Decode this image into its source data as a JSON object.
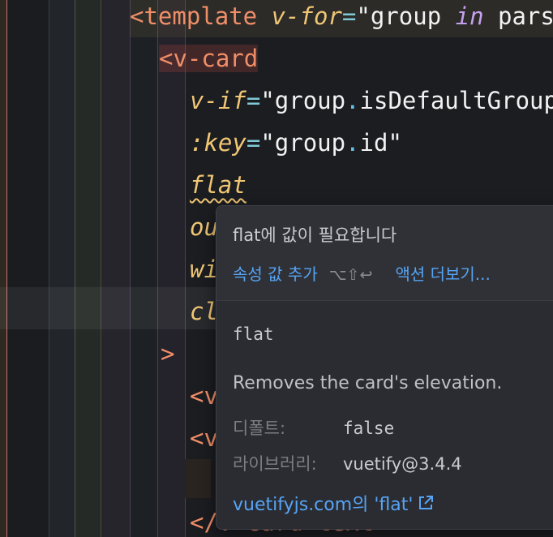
{
  "code": {
    "line1": {
      "open": "<template",
      "attr": "v-for",
      "eq": "=",
      "val": "\"group ",
      "kw": "in",
      "rest": " parse"
    },
    "line2": {
      "tag": "<v-card"
    },
    "line3": {
      "attr": "v-if",
      "eq": "=",
      "q1": "\"group",
      "dot": ".",
      "val": "isDefaultGroup\""
    },
    "line4": {
      "attr": ":key",
      "eq": "=",
      "q1": "\"group",
      "dot": ".",
      "val": "id\""
    },
    "line5": {
      "attr": "flat"
    },
    "line6": {
      "attr": "ou"
    },
    "line7": {
      "attr": "wi"
    },
    "line8": {
      "attr": "cl"
    },
    "line9": {
      "tag": ">"
    },
    "line10": {
      "tag": "<v"
    },
    "line11": {
      "tag": "<v"
    },
    "line13": {
      "tag": "</v-card-text>"
    }
  },
  "popup": {
    "problem": "flat에 값이 필요합니다",
    "action_add": "속성 값 추가",
    "action_shortcut": "⌥⇧↩",
    "action_more": "액션 더보기...",
    "name": "flat",
    "description": "Removes the card's elevation.",
    "default_label": "디폴트:",
    "default_value": "false",
    "library_label": "라이브러리:",
    "library_value": "vuetify@3.4.4",
    "link": "vuetifyjs.com의 'flat'"
  },
  "colors": {
    "tag": "#f08e68",
    "attr": "#f0c674",
    "link": "#57a4f5"
  }
}
